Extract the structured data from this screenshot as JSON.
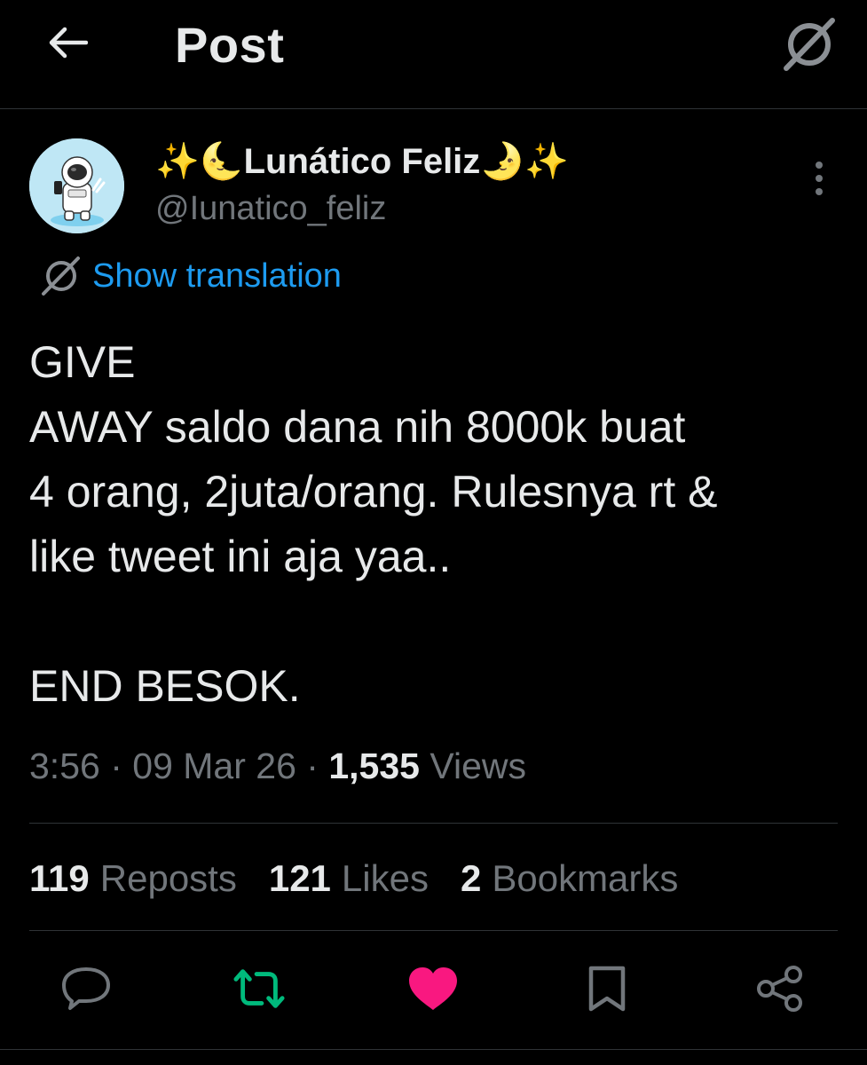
{
  "header": {
    "title": "Post",
    "back_icon": "arrow-left-icon",
    "action_icon": "grok-icon"
  },
  "author": {
    "display_name": "✨🌜Lunático Feliz🌛✨",
    "handle": "@Iunatico_feliz",
    "avatar_icon": "astronaut-avatar"
  },
  "translation": {
    "label": "Show translation",
    "icon": "grok-icon"
  },
  "post": {
    "lines": [
      "GIVE",
      "AWAY saldo dana nih 8000k buat",
      "4 orang, 2juta/orang. Rulesnya rt &",
      "like tweet ini aja yaa..",
      "",
      "END BESOK."
    ]
  },
  "meta": {
    "time": "3:56",
    "date": "09 Mar 26",
    "views_count": "1,535",
    "views_label": "Views",
    "separator": "·"
  },
  "stats": [
    {
      "count": "119",
      "label": "Reposts"
    },
    {
      "count": "121",
      "label": "Likes"
    },
    {
      "count": "2",
      "label": "Bookmarks"
    }
  ],
  "actions": [
    {
      "icon": "reply-icon",
      "color": "#71767b"
    },
    {
      "icon": "repost-icon",
      "color": "#00ba7c"
    },
    {
      "icon": "like-icon",
      "color": "#f91880"
    },
    {
      "icon": "bookmark-icon",
      "color": "#71767b"
    },
    {
      "icon": "share-icon",
      "color": "#71767b"
    }
  ],
  "colors": {
    "background": "#000000",
    "text": "#e7e9ea",
    "muted": "#71767b",
    "link": "#1d9bf0",
    "repost_active": "#00ba7c",
    "like_active": "#f91880"
  }
}
